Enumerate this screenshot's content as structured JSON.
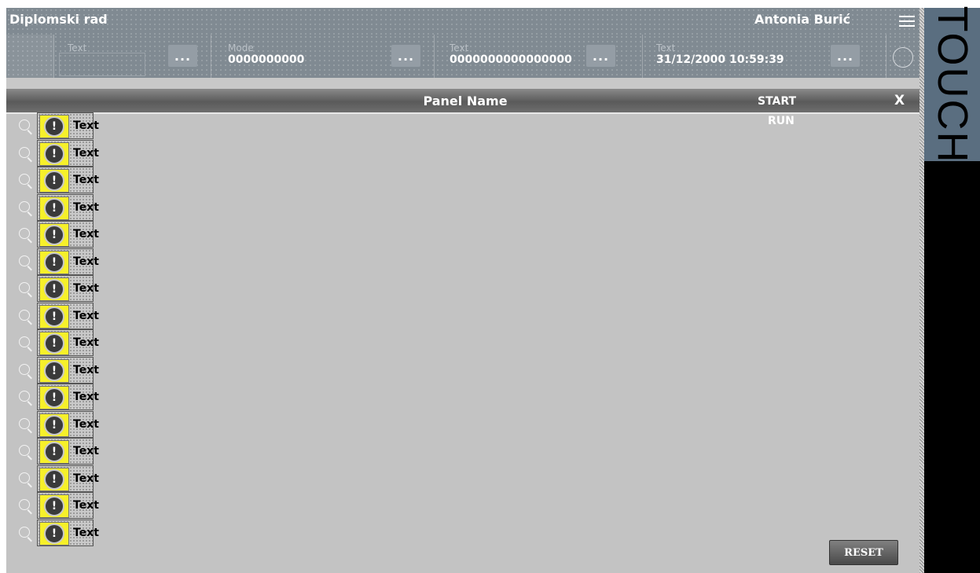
{
  "header": {
    "title": "Diplomski rad",
    "user": "Antonia Burić",
    "menu_icon": "hamburger-menu-icon"
  },
  "infobar": {
    "text_field_label": "Text",
    "more_label": "...",
    "mode": {
      "label": "Mode",
      "value": "0000000000"
    },
    "text_value": {
      "label": "Text",
      "value": "0000000000000000"
    },
    "datetime": {
      "label": "Text",
      "value": "31/12/2000 10:59:39"
    },
    "status_icon": "circle-icon"
  },
  "panel": {
    "name": "Panel Name",
    "start_label": "START",
    "run_label": "RUN",
    "close_label": "X"
  },
  "alarms": [
    {
      "text": "Text"
    },
    {
      "text": "Text"
    },
    {
      "text": "Text"
    },
    {
      "text": "Text"
    },
    {
      "text": "Text"
    },
    {
      "text": "Text"
    },
    {
      "text": "Text"
    },
    {
      "text": "Text"
    },
    {
      "text": "Text"
    },
    {
      "text": "Text"
    },
    {
      "text": "Text"
    },
    {
      "text": "Text"
    },
    {
      "text": "Text"
    },
    {
      "text": "Text"
    },
    {
      "text": "Text"
    },
    {
      "text": "Text"
    }
  ],
  "alarm_glyph": "!",
  "reset_label": "RESET",
  "side_label": "TOUCH",
  "colors": {
    "header_bg": "#808a92",
    "panel_bg": "#c3c3c3",
    "alarm_yellow": "#f6f02a",
    "side_band": "#5a6e80"
  }
}
